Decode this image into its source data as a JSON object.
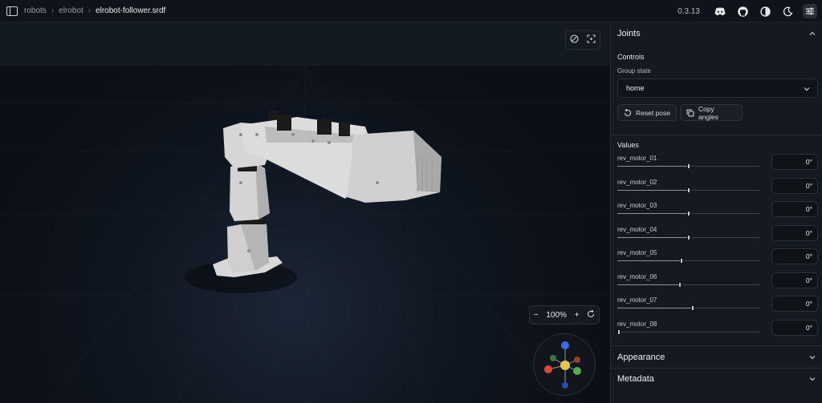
{
  "breadcrumb": [
    "robots",
    "elrobot",
    "elrobot-follower.srdf"
  ],
  "version": "0.3.13",
  "toolbar_icons": [
    "discord-icon",
    "github-icon",
    "contrast-icon",
    "moon-icon",
    "settings-sliders-icon"
  ],
  "zoom": {
    "value": "100%",
    "minus": "−",
    "plus": "+"
  },
  "panel": {
    "joints_title": "Joints",
    "controls_title": "Controls",
    "group_state_label": "Group state",
    "group_state_value": "home",
    "reset_pose": "Reset pose",
    "copy_angles": "Copy angles",
    "values_title": "Values",
    "joints": [
      {
        "name": "rev_motor_01",
        "value": "0°",
        "position": 0.5
      },
      {
        "name": "rev_motor_02",
        "value": "0°",
        "position": 0.5
      },
      {
        "name": "rev_motor_03",
        "value": "0°",
        "position": 0.5
      },
      {
        "name": "rev_motor_04",
        "value": "0°",
        "position": 0.5
      },
      {
        "name": "rev_motor_05",
        "value": "0°",
        "position": 0.45
      },
      {
        "name": "rev_motor_06",
        "value": "0°",
        "position": 0.44
      },
      {
        "name": "rev_motor_07",
        "value": "0°",
        "position": 0.53
      },
      {
        "name": "rev_motor_08",
        "value": "0°",
        "position": 0.0
      }
    ],
    "appearance_title": "Appearance",
    "metadata_title": "Metadata"
  }
}
